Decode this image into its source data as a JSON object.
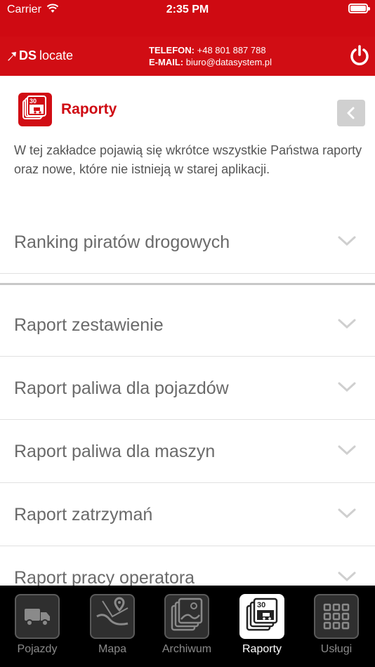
{
  "status_bar": {
    "carrier": "Carrier",
    "time": "2:35 PM"
  },
  "header": {
    "logo_ds": "DS",
    "logo_locate": "locate",
    "phone_label": "TELEFON:",
    "phone_value": "+48 801 887 788",
    "email_label": "E-MAIL:",
    "email_value": "biuro@datasystem.pl"
  },
  "section": {
    "icon_number": "30",
    "title": "Raporty",
    "intro": "W tej zakładce pojawią się wkrótce wszystkie Państwa raporty oraz nowe, które nie istnieją w starej aplikacji."
  },
  "reports_top": [
    {
      "label": "Ranking piratów drogowych"
    }
  ],
  "reports": [
    {
      "label": "Raport zestawienie"
    },
    {
      "label": "Raport paliwa dla pojazdów"
    },
    {
      "label": "Raport paliwa dla maszyn"
    },
    {
      "label": "Raport zatrzymań"
    },
    {
      "label": "Raport pracy operatora"
    }
  ],
  "tabs": [
    {
      "label": "Pojazdy",
      "icon": "truck-icon"
    },
    {
      "label": "Mapa",
      "icon": "map-icon"
    },
    {
      "label": "Archiwum",
      "icon": "archive-icon"
    },
    {
      "label": "Raporty",
      "icon": "reports-icon",
      "active": true,
      "number": "30"
    },
    {
      "label": "Usługi",
      "icon": "grid-icon"
    }
  ],
  "colors": {
    "brand_red": "#d10d14",
    "tab_bg": "#000000",
    "text_gray": "#6a6a6a"
  }
}
